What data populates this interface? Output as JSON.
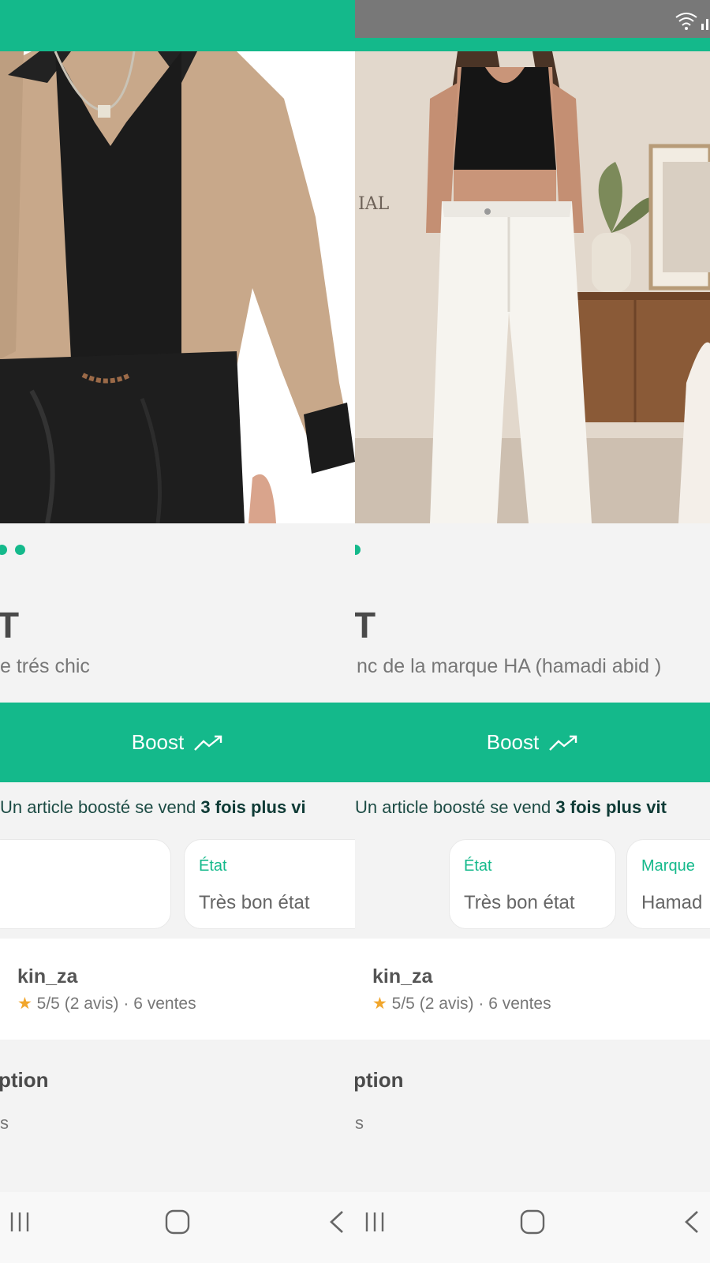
{
  "left_screen": {
    "title_letter": "T",
    "subtitle": "e trés chic",
    "boost_label": "Boost",
    "promo_prefix": "Un article boosté se vend",
    "promo_bold": "3 fois plus vi",
    "attributes": [
      {
        "label": "État",
        "value": "Très bon état"
      }
    ],
    "seller": {
      "name": "kin_za",
      "star": "★",
      "rating": "5/5 (2 avis) · 6 ventes"
    },
    "description_title": "ption",
    "description_text": "s"
  },
  "right_screen": {
    "title_letter": "T",
    "subtitle": "nc de la marque HA (hamadi abid )",
    "boost_label": "Boost",
    "promo_prefix": "Un article boosté se vend",
    "promo_bold": "3 fois plus vit",
    "attributes": [
      {
        "label": "État",
        "value": "Très bon état"
      },
      {
        "label": "Marque",
        "value": "Hamad"
      }
    ],
    "seller": {
      "name": "kin_za",
      "star": "★",
      "rating": "5/5 (2 avis) · 6 ventes"
    },
    "description_title": "ption",
    "description_text": "s",
    "photo_watermark": "IAL"
  },
  "colors": {
    "accent": "#14b98b",
    "status_gray": "#787878",
    "text_dark": "#4a4a4a"
  },
  "icons": {
    "boost": "trending-up-icon",
    "nav_recents": "recents-icon",
    "nav_home": "home-icon",
    "nav_back": "back-icon",
    "wifi": "wifi-icon",
    "signal": "signal-icon"
  }
}
